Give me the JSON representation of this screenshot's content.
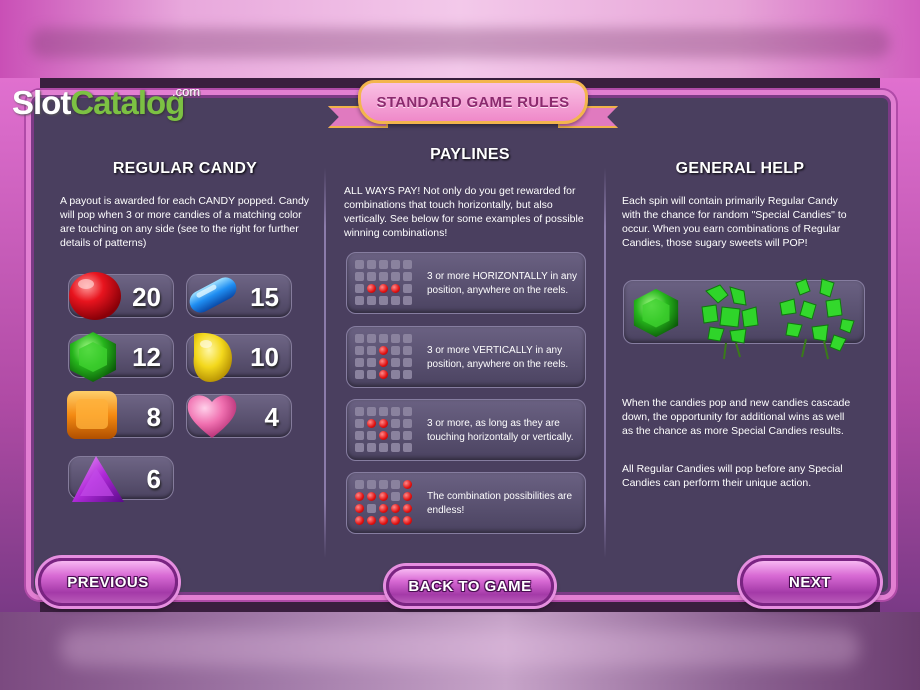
{
  "logo": {
    "slot": "Slot",
    "catalog": "Catalog",
    "com": ".com"
  },
  "banner": {
    "title": "STANDARD GAME RULES"
  },
  "regular_candy": {
    "heading": "REGULAR CANDY",
    "description": "A payout is awarded for each CANDY popped. Candy will pop when 3 or more candies of a matching color are touching on any side (see to the right for further details of patterns)",
    "payouts": [
      {
        "candy": "red-round-candy",
        "value": "20",
        "color": "#e0101c"
      },
      {
        "candy": "blue-stick-candy",
        "value": "15",
        "color": "#2a8ef0"
      },
      {
        "candy": "green-hexagon-candy",
        "value": "12",
        "color": "#26b51c"
      },
      {
        "candy": "yellow-drop-candy",
        "value": "10",
        "color": "#f3d81c"
      },
      {
        "candy": "orange-square-candy",
        "value": "8",
        "color": "#f48a12"
      },
      {
        "candy": "pink-heart-candy",
        "value": "4",
        "color": "#f070b0"
      },
      {
        "candy": "purple-triangle-candy",
        "value": "6",
        "color": "#b02ad8"
      }
    ]
  },
  "paylines": {
    "heading": "PAYLINES",
    "description": "ALL WAYS PAY! Not only do you get rewarded for combinations that touch horizontally, but also vertically. See below for some examples of possible winning combinations!",
    "examples": [
      {
        "text": "3 or more HORIZONTALLY in any position, anywhere on the reels."
      },
      {
        "text": "3 or more VERTICALLY in any position, anywhere on the reels."
      },
      {
        "text": "3 or more, as long as they are touching horizontally or vertically."
      },
      {
        "text": "The combination possibilities are endless!"
      }
    ]
  },
  "general_help": {
    "heading": "GENERAL HELP",
    "description": "Each spin will contain primarily Regular Candy with the chance for random \"Special Candies\" to occur. When you earn combinations of Regular Candies, those sugary sweets will POP!",
    "cascade_text": "When the candies pop and new candies cascade down, the opportunity for additional wins as well as the chance as more Special Candies results.",
    "order_text": "All Regular Candies will pop before any Special Candies can perform their unique action."
  },
  "buttons": {
    "previous": "PREVIOUS",
    "back": "BACK TO GAME",
    "next": "NEXT"
  }
}
